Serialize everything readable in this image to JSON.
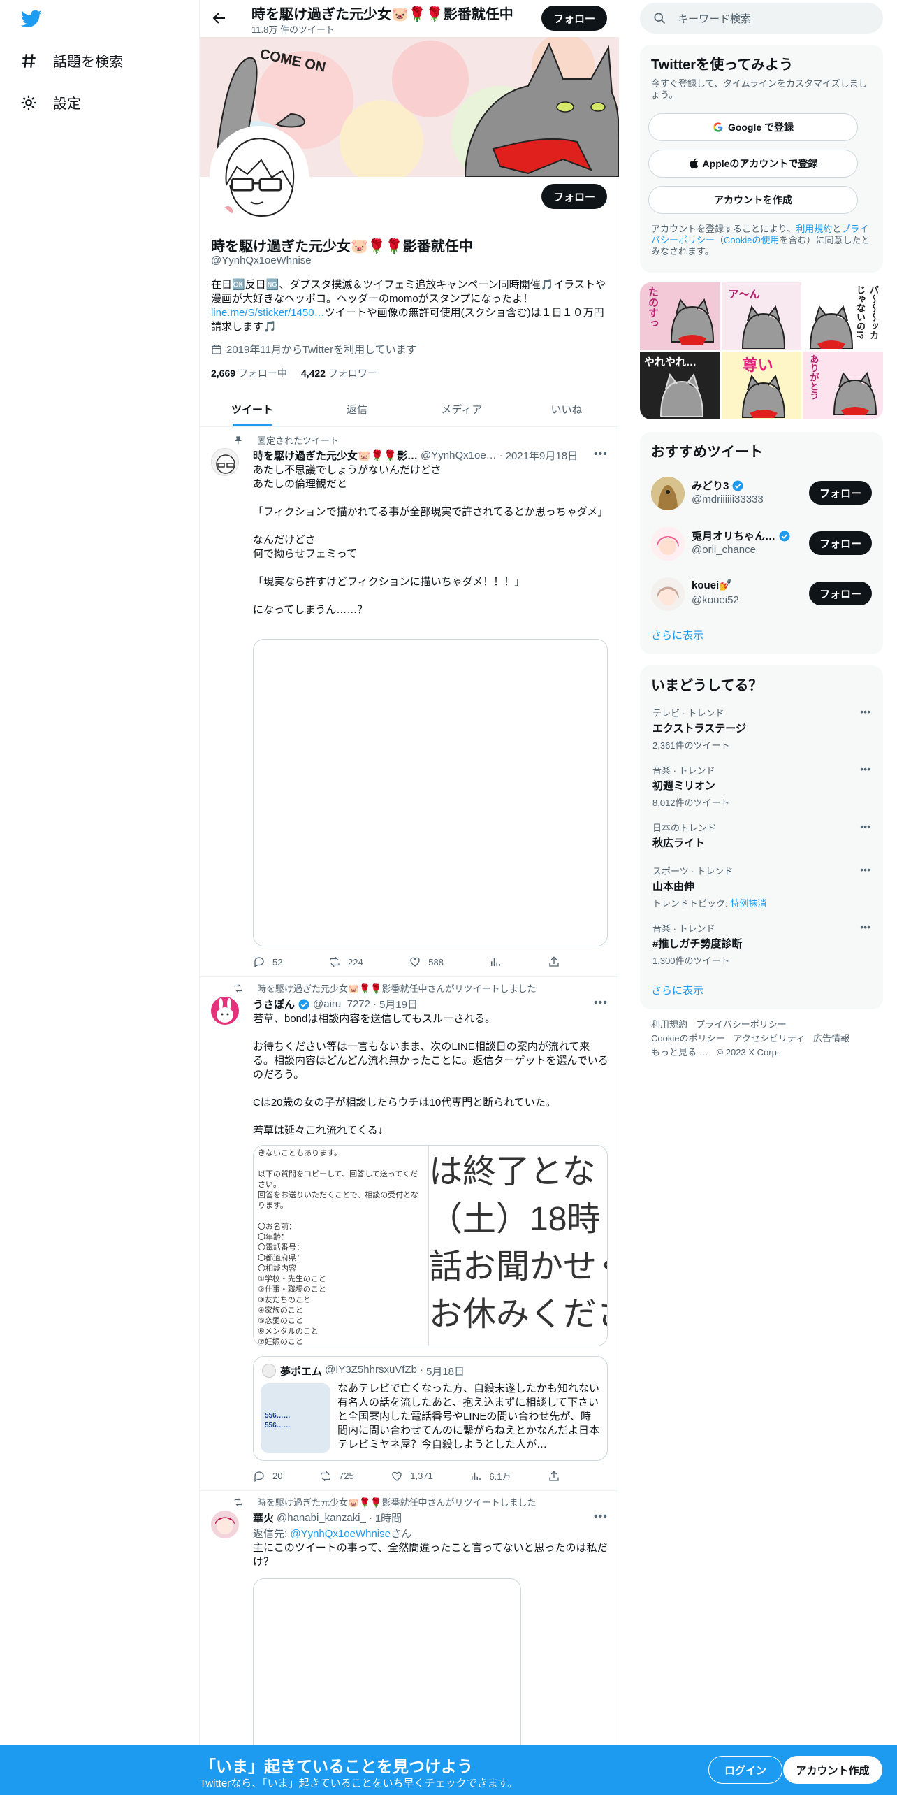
{
  "nav": {
    "explore_label": "話題を検索",
    "settings_label": "設定"
  },
  "header": {
    "title": "時を駆け過ぎた元少女🐷🌹🌹影番就任中",
    "tweet_count": "11.8万 件のツイート",
    "follow_label": "フォロー"
  },
  "banner": {
    "text": "COME ON"
  },
  "profile": {
    "name": "時を駆け過ぎた元少女🐷🌹🌹影番就任中",
    "handle": "@YynhQx1oeWhnise",
    "follow_label": "フォロー",
    "bio_part1": "在日🆗反日🆖、ダブスタ撲滅＆ツイフェミ追放キャンペーン同時開催🎵イラストや漫画が大好きなヘッポコ。ヘッダーのmomoがスタンプになったよ！",
    "bio_link": "line.me/S/sticker/1450…",
    "bio_part2": "ツイートや画像の無許可使用(スクショ含む)は１日１０万円請求します🎵",
    "joined": "2019年11月からTwitterを利用しています",
    "following_count": "2,669",
    "following_label": "フォロー中",
    "followers_count": "4,422",
    "followers_label": "フォロワー"
  },
  "tabs": [
    "ツイート",
    "返信",
    "メディア",
    "いいね"
  ],
  "tweets": [
    {
      "context": "固定されたツイート",
      "name": "時を駆け過ぎた元少女🐷🌹🌹影…",
      "handle": "@YynhQx1oe…",
      "date": "2021年9月18日",
      "text": "あたし不思議でしょうがないんだけどさ\nあたしの倫理観だと\n\n「フィクションで描かれてる事が全部現実で許されてるとか思っちゃダメ」\n\nなんだけどさ\n何で拗らせフェミって\n\n「現実なら許すけどフィクションに描いちゃダメ！！！」\n\nになってしまうん……？",
      "replies": "52",
      "retweets": "224",
      "likes": "588"
    },
    {
      "context": "時を駆け過ぎた元少女🐷🌹🌹影番就任中さんがリツイートしました",
      "name": "うさぽん",
      "handle": "@airu_7272",
      "date": "5月19日",
      "text": "若草、bondは相談内容を送信してもスルーされる。\n\nお待ちください等は一言もないまま、次のLINE相談日の案内が流れて来る。相談内容はどんどん流れ無かったことに。返信ターゲットを選んでいるのだろう。\n\nCは20歳の女の子が相談したらウチは10代専門と断られていた。\n\n若草は延々これ流れてくる↓",
      "media_left": "きないこともあります。\n\n以下の質問をコピーして、回答して送ってください。\n回答をお送りいただくことで、相談の受付となります。\n\n〇お名前：\n〇年齢：\n〇電話番号：\n〇都道府県：\n〇相談内容\n①学校・先生のこと\n②仕事・職場のこと\n③友だちのこと\n④家族のこと\n⑤恋愛のこと\n⑥メンタルのこと\n⑦妊娠のこと",
      "media_right": "は終了とな\n（土）18時\n話お聞かせく\nお休みくださ",
      "quote_name": "夢ポエム",
      "quote_handle": "@IY3Z5hhrsxuVfZb",
      "quote_date": "5月18日",
      "quote_text": "なあテレビで亡くなった方、自殺未遂したかも知れない有名人の話を流したあと、抱え込まずに相談して下さいと全国案内した電話番号やLINEの問い合わせ先が、時間内に問い合わせてんのに繋がらねえとかなんだよ日本テレビミヤネ屋？今自殺しようとした人が…",
      "quote_img_text": "556……\n556……",
      "replies": "20",
      "retweets": "725",
      "likes": "1,371",
      "views": "6.1万"
    },
    {
      "context": "時を駆け過ぎた元少女🐷🌹🌹影番就任中さんがリツイートしました",
      "name": "華火",
      "handle": "@hanabi_kanzaki_",
      "date": "1時間",
      "reply_label": "返信先:",
      "reply_to": "@YynhQx1oeWhnise",
      "reply_suffix": "さん",
      "text": "主にこのツイートの事って、全然間違ったこと言ってないと思ったのは私だけ？"
    }
  ],
  "right": {
    "search_placeholder": "キーワード検索",
    "signup_title": "Twitterを使ってみよう",
    "signup_desc": "今すぐ登録して、タイムラインをカスタマイズしましょう。",
    "google_label": "Google で登録",
    "apple_label": "Appleのアカウントで登録",
    "create_label": "アカウントを作成",
    "terms_1": "アカウントを登録することにより、",
    "terms_link1": "利用規約",
    "terms_2": "と",
    "terms_link2": "プライバシーポリシー",
    "terms_3": "（",
    "terms_link3": "Cookieの使用",
    "terms_4": "を含む）に同意したとみなされます。",
    "stickers": [
      "たのすっ",
      "ア〜ん",
      "パ〜〜〜ッカじゃないの!?",
      "やれやれ…",
      "尊い",
      "ありがとう"
    ],
    "rec_title": "おすすめツイート",
    "recs": [
      {
        "name": "みどり3",
        "handle": "@mdriiiiii33333",
        "follow": "フォロー"
      },
      {
        "name": "兎月オリちゃん…",
        "handle": "@orii_chance",
        "follow": "フォロー"
      },
      {
        "name": "kouei💅",
        "handle": "@kouei52",
        "follow": "フォロー"
      }
    ],
    "show_more": "さらに表示",
    "trends_title": "いまどうしてる？",
    "trends": [
      {
        "context": "テレビ · トレンド",
        "name": "エクストラステージ",
        "count": "2,361件のツイート"
      },
      {
        "context": "音楽 · トレンド",
        "name": "初週ミリオン",
        "count": "8,012件のツイート"
      },
      {
        "context": "日本のトレンド",
        "name": "秋広ライト",
        "count": ""
      },
      {
        "context": "スポーツ · トレンド",
        "name": "山本由伸",
        "count": "トレンドトピック: ",
        "topic": "特例抹消"
      },
      {
        "context": "音楽 · トレンド",
        "name": "#推しガチ勢度診断",
        "count": "1,300件のツイート"
      }
    ],
    "trends_more": "さらに表示",
    "footer": [
      "利用規約",
      "プライバシーポリシー",
      "Cookieのポリシー",
      "アクセシビリティ",
      "広告情報",
      "もっと見る …",
      "© 2023 X Corp."
    ]
  },
  "bottom_bar": {
    "title": "「いま」起きていることを見つけよう",
    "subtitle": "Twitterなら、「いま」起きていることをいち早くチェックできます。",
    "login": "ログイン",
    "signup": "アカウント作成"
  },
  "colors": {
    "accent": "#1d9bf0",
    "dark": "#0f1419",
    "muted": "#536471",
    "verified": "#1d9bf0"
  }
}
